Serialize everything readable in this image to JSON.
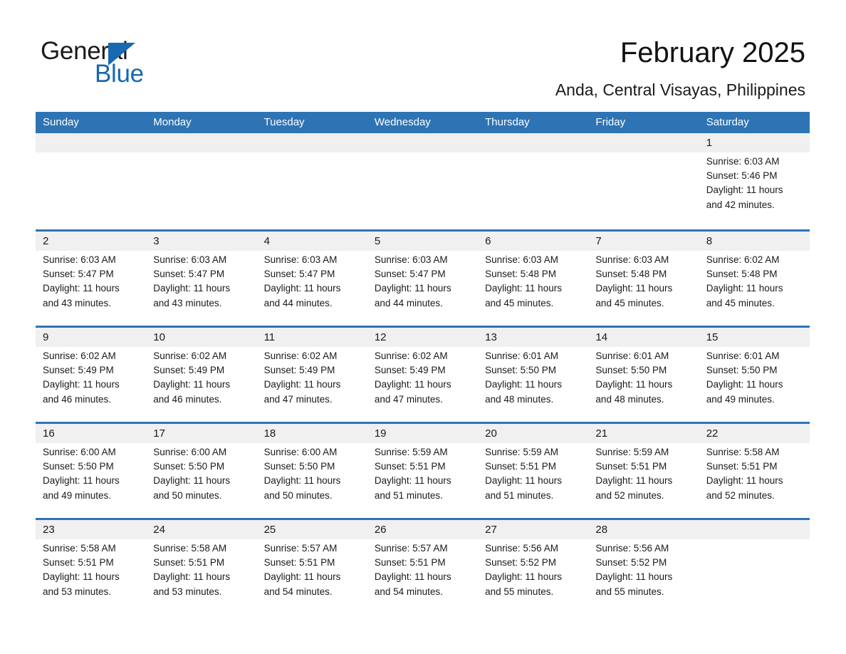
{
  "logo": {
    "word1": "General",
    "word2": "Blue",
    "triangle_color": "#1769b0",
    "word1_color": "#1a1a1a",
    "word2_color": "#1769b0"
  },
  "header": {
    "title": "February 2025",
    "location": "Anda, Central Visayas, Philippines"
  },
  "theme": {
    "header_blue": "#2e74b5",
    "row_band_gray": "#f0f0f0",
    "text_color": "#1a1a1a",
    "background": "#ffffff"
  },
  "weekdays": [
    "Sunday",
    "Monday",
    "Tuesday",
    "Wednesday",
    "Thursday",
    "Friday",
    "Saturday"
  ],
  "weeks": [
    [
      {
        "day": "",
        "sunrise": "",
        "sunset": "",
        "daylight1": "",
        "daylight2": ""
      },
      {
        "day": "",
        "sunrise": "",
        "sunset": "",
        "daylight1": "",
        "daylight2": ""
      },
      {
        "day": "",
        "sunrise": "",
        "sunset": "",
        "daylight1": "",
        "daylight2": ""
      },
      {
        "day": "",
        "sunrise": "",
        "sunset": "",
        "daylight1": "",
        "daylight2": ""
      },
      {
        "day": "",
        "sunrise": "",
        "sunset": "",
        "daylight1": "",
        "daylight2": ""
      },
      {
        "day": "",
        "sunrise": "",
        "sunset": "",
        "daylight1": "",
        "daylight2": ""
      },
      {
        "day": "1",
        "sunrise": "Sunrise: 6:03 AM",
        "sunset": "Sunset: 5:46 PM",
        "daylight1": "Daylight: 11 hours",
        "daylight2": "and 42 minutes."
      }
    ],
    [
      {
        "day": "2",
        "sunrise": "Sunrise: 6:03 AM",
        "sunset": "Sunset: 5:47 PM",
        "daylight1": "Daylight: 11 hours",
        "daylight2": "and 43 minutes."
      },
      {
        "day": "3",
        "sunrise": "Sunrise: 6:03 AM",
        "sunset": "Sunset: 5:47 PM",
        "daylight1": "Daylight: 11 hours",
        "daylight2": "and 43 minutes."
      },
      {
        "day": "4",
        "sunrise": "Sunrise: 6:03 AM",
        "sunset": "Sunset: 5:47 PM",
        "daylight1": "Daylight: 11 hours",
        "daylight2": "and 44 minutes."
      },
      {
        "day": "5",
        "sunrise": "Sunrise: 6:03 AM",
        "sunset": "Sunset: 5:47 PM",
        "daylight1": "Daylight: 11 hours",
        "daylight2": "and 44 minutes."
      },
      {
        "day": "6",
        "sunrise": "Sunrise: 6:03 AM",
        "sunset": "Sunset: 5:48 PM",
        "daylight1": "Daylight: 11 hours",
        "daylight2": "and 45 minutes."
      },
      {
        "day": "7",
        "sunrise": "Sunrise: 6:03 AM",
        "sunset": "Sunset: 5:48 PM",
        "daylight1": "Daylight: 11 hours",
        "daylight2": "and 45 minutes."
      },
      {
        "day": "8",
        "sunrise": "Sunrise: 6:02 AM",
        "sunset": "Sunset: 5:48 PM",
        "daylight1": "Daylight: 11 hours",
        "daylight2": "and 45 minutes."
      }
    ],
    [
      {
        "day": "9",
        "sunrise": "Sunrise: 6:02 AM",
        "sunset": "Sunset: 5:49 PM",
        "daylight1": "Daylight: 11 hours",
        "daylight2": "and 46 minutes."
      },
      {
        "day": "10",
        "sunrise": "Sunrise: 6:02 AM",
        "sunset": "Sunset: 5:49 PM",
        "daylight1": "Daylight: 11 hours",
        "daylight2": "and 46 minutes."
      },
      {
        "day": "11",
        "sunrise": "Sunrise: 6:02 AM",
        "sunset": "Sunset: 5:49 PM",
        "daylight1": "Daylight: 11 hours",
        "daylight2": "and 47 minutes."
      },
      {
        "day": "12",
        "sunrise": "Sunrise: 6:02 AM",
        "sunset": "Sunset: 5:49 PM",
        "daylight1": "Daylight: 11 hours",
        "daylight2": "and 47 minutes."
      },
      {
        "day": "13",
        "sunrise": "Sunrise: 6:01 AM",
        "sunset": "Sunset: 5:50 PM",
        "daylight1": "Daylight: 11 hours",
        "daylight2": "and 48 minutes."
      },
      {
        "day": "14",
        "sunrise": "Sunrise: 6:01 AM",
        "sunset": "Sunset: 5:50 PM",
        "daylight1": "Daylight: 11 hours",
        "daylight2": "and 48 minutes."
      },
      {
        "day": "15",
        "sunrise": "Sunrise: 6:01 AM",
        "sunset": "Sunset: 5:50 PM",
        "daylight1": "Daylight: 11 hours",
        "daylight2": "and 49 minutes."
      }
    ],
    [
      {
        "day": "16",
        "sunrise": "Sunrise: 6:00 AM",
        "sunset": "Sunset: 5:50 PM",
        "daylight1": "Daylight: 11 hours",
        "daylight2": "and 49 minutes."
      },
      {
        "day": "17",
        "sunrise": "Sunrise: 6:00 AM",
        "sunset": "Sunset: 5:50 PM",
        "daylight1": "Daylight: 11 hours",
        "daylight2": "and 50 minutes."
      },
      {
        "day": "18",
        "sunrise": "Sunrise: 6:00 AM",
        "sunset": "Sunset: 5:50 PM",
        "daylight1": "Daylight: 11 hours",
        "daylight2": "and 50 minutes."
      },
      {
        "day": "19",
        "sunrise": "Sunrise: 5:59 AM",
        "sunset": "Sunset: 5:51 PM",
        "daylight1": "Daylight: 11 hours",
        "daylight2": "and 51 minutes."
      },
      {
        "day": "20",
        "sunrise": "Sunrise: 5:59 AM",
        "sunset": "Sunset: 5:51 PM",
        "daylight1": "Daylight: 11 hours",
        "daylight2": "and 51 minutes."
      },
      {
        "day": "21",
        "sunrise": "Sunrise: 5:59 AM",
        "sunset": "Sunset: 5:51 PM",
        "daylight1": "Daylight: 11 hours",
        "daylight2": "and 52 minutes."
      },
      {
        "day": "22",
        "sunrise": "Sunrise: 5:58 AM",
        "sunset": "Sunset: 5:51 PM",
        "daylight1": "Daylight: 11 hours",
        "daylight2": "and 52 minutes."
      }
    ],
    [
      {
        "day": "23",
        "sunrise": "Sunrise: 5:58 AM",
        "sunset": "Sunset: 5:51 PM",
        "daylight1": "Daylight: 11 hours",
        "daylight2": "and 53 minutes."
      },
      {
        "day": "24",
        "sunrise": "Sunrise: 5:58 AM",
        "sunset": "Sunset: 5:51 PM",
        "daylight1": "Daylight: 11 hours",
        "daylight2": "and 53 minutes."
      },
      {
        "day": "25",
        "sunrise": "Sunrise: 5:57 AM",
        "sunset": "Sunset: 5:51 PM",
        "daylight1": "Daylight: 11 hours",
        "daylight2": "and 54 minutes."
      },
      {
        "day": "26",
        "sunrise": "Sunrise: 5:57 AM",
        "sunset": "Sunset: 5:51 PM",
        "daylight1": "Daylight: 11 hours",
        "daylight2": "and 54 minutes."
      },
      {
        "day": "27",
        "sunrise": "Sunrise: 5:56 AM",
        "sunset": "Sunset: 5:52 PM",
        "daylight1": "Daylight: 11 hours",
        "daylight2": "and 55 minutes."
      },
      {
        "day": "28",
        "sunrise": "Sunrise: 5:56 AM",
        "sunset": "Sunset: 5:52 PM",
        "daylight1": "Daylight: 11 hours",
        "daylight2": "and 55 minutes."
      },
      {
        "day": "",
        "sunrise": "",
        "sunset": "",
        "daylight1": "",
        "daylight2": ""
      }
    ]
  ]
}
